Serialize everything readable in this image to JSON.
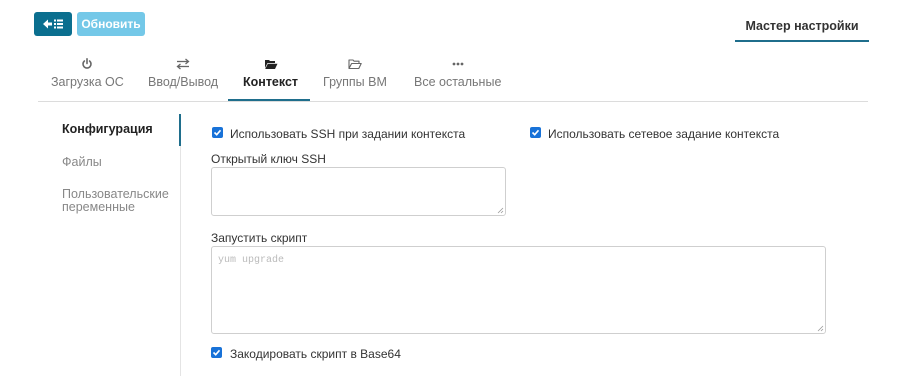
{
  "toolbar": {
    "back_icon": "arrow-left-list-icon",
    "refresh_label": "Обновить",
    "wizard_label": "Мастер настройки"
  },
  "tabs": [
    {
      "label": "Загрузка ОС",
      "icon": "power-icon",
      "active": false
    },
    {
      "label": "Ввод/Вывод",
      "icon": "exchange-icon",
      "active": false
    },
    {
      "label": "Контекст",
      "icon": "folder-open-solid-icon",
      "active": true
    },
    {
      "label": "Группы ВМ",
      "icon": "folder-open-outline-icon",
      "active": false
    },
    {
      "label": "Все остальные",
      "icon": "ellipsis-icon",
      "active": false
    }
  ],
  "sidebar": {
    "items": [
      {
        "label": "Конфигурация",
        "active": true
      },
      {
        "label": "Файлы",
        "active": false
      },
      {
        "label": "Пользовательские переменные",
        "active": false
      }
    ]
  },
  "config": {
    "ssh_checkbox_label": "Использовать SSH при задании контекста",
    "ssh_checked": true,
    "network_checkbox_label": "Использовать сетевое задание контекста",
    "network_checked": true,
    "ssh_key_label": "Открытый ключ SSH",
    "ssh_key_value": "",
    "script_label": "Запустить скрипт",
    "script_placeholder": "yum upgrade",
    "base64_checkbox_label": "Закодировать скрипт в Base64",
    "base64_checked": true
  },
  "colors": {
    "primary": "#0b6f8f",
    "refresh_button": "#74c8e8",
    "checkbox": "#1872d8",
    "accent_line": "#1f6e8c"
  }
}
